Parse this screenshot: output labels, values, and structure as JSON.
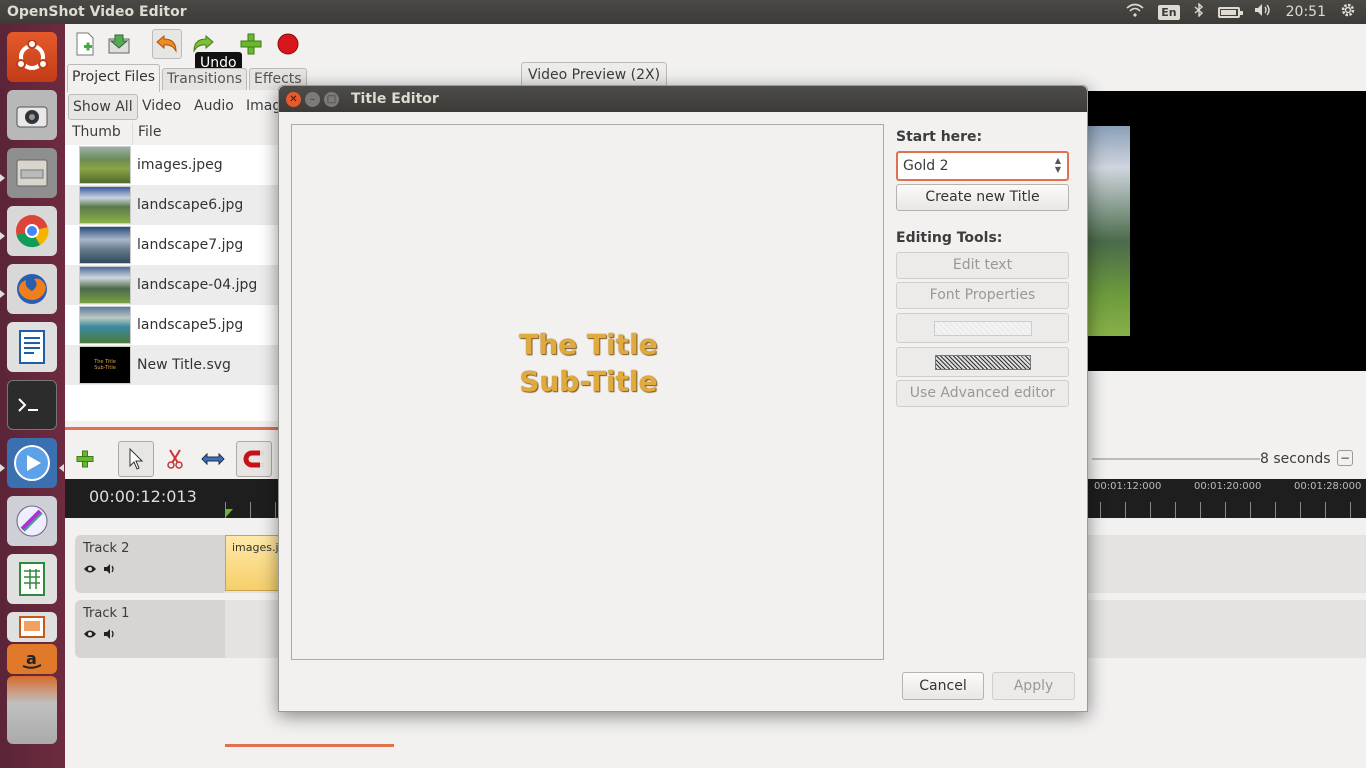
{
  "topbar": {
    "app_title": "OpenShot Video Editor",
    "keyboard": "En",
    "clock": "20:51",
    "icons": [
      "wifi-icon",
      "bluetooth-icon",
      "battery-icon",
      "volume-icon",
      "settings-gear-icon"
    ]
  },
  "launcher": {
    "items": [
      "ubuntu-dash",
      "camera-app",
      "file-manager",
      "chrome",
      "firefox",
      "libreoffice-writer",
      "terminal",
      "openshot",
      "inkscape",
      "libreoffice-calc",
      "libreoffice-impress",
      "amazon",
      "trash-stack"
    ]
  },
  "toolbar": {
    "tooltip": "Undo",
    "buttons": [
      "new-project",
      "save-project",
      "undo",
      "redo",
      "add-files",
      "record"
    ]
  },
  "tabs": {
    "project_files": "Project Files",
    "transitions": "Transitions",
    "effects": "Effects"
  },
  "filters": {
    "show_all": "Show All",
    "video": "Video",
    "audio": "Audio",
    "image": "Imag"
  },
  "files": {
    "col_thumb": "Thumb",
    "col_file": "File",
    "items": [
      {
        "name": "images.jpeg"
      },
      {
        "name": "landscape6.jpg"
      },
      {
        "name": "landscape7.jpg"
      },
      {
        "name": "landscape-04.jpg"
      },
      {
        "name": "landscape5.jpg"
      },
      {
        "name": "New Title.svg"
      }
    ],
    "svg_thumb_line1": "The Title",
    "svg_thumb_line2": "Sub-Title"
  },
  "preview": {
    "label": "Video Preview (2X)"
  },
  "timeline": {
    "timecode": "00:00:12:013",
    "zoom_label": "8 seconds",
    "ticks": [
      "00:01:12:000",
      "00:01:20:000",
      "00:01:28:000"
    ],
    "tracks": [
      {
        "name": "Track 2",
        "clip": "images.j"
      },
      {
        "name": "Track 1",
        "clip": ""
      }
    ]
  },
  "dialog": {
    "title": "Title Editor",
    "canvas_title": "The Title",
    "canvas_subtitle": "Sub-Title",
    "start_here": "Start here:",
    "template_selected": "Gold 2",
    "create_new": "Create new Title",
    "editing_tools": "Editing Tools:",
    "edit_text": "Edit text",
    "font_properties": "Font Properties",
    "use_advanced": "Use Advanced editor",
    "cancel": "Cancel",
    "apply": "Apply",
    "colors": {
      "title_text": "#e0aa3e",
      "accent": "#e07050"
    }
  }
}
